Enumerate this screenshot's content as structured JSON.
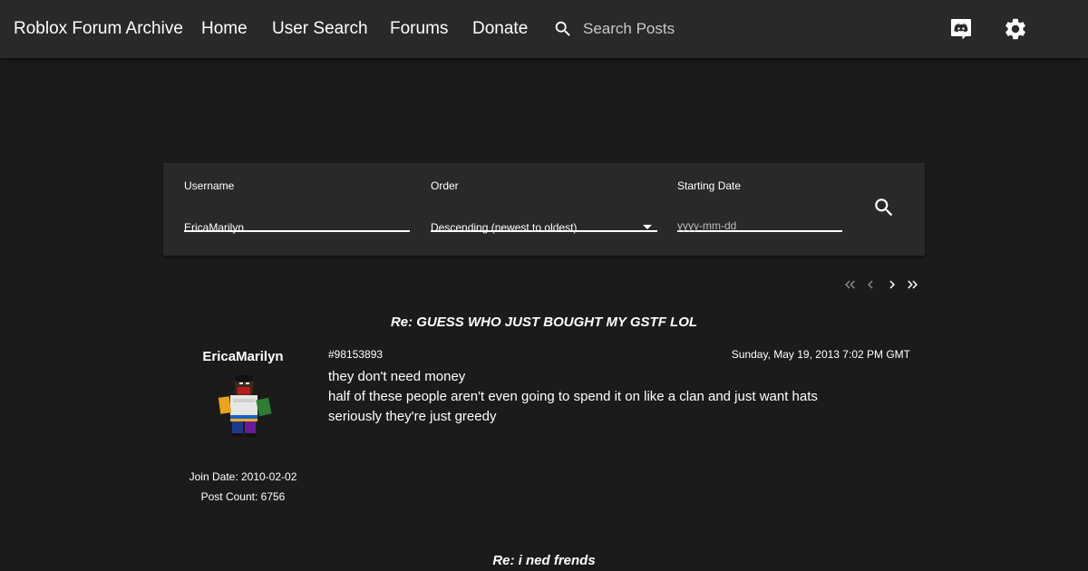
{
  "nav": {
    "brand": "Roblox Forum Archive",
    "links": [
      "Home",
      "User Search",
      "Forums",
      "Donate"
    ],
    "search_placeholder": "Search Posts",
    "icons": [
      "search-icon",
      "discord-icon",
      "gear-icon"
    ]
  },
  "filters": {
    "username_label": "Username",
    "username_value": "EricaMarilyn",
    "order_label": "Order",
    "order_value": "Descending (newest to oldest)",
    "date_label": "Starting Date",
    "date_placeholder": "yyyy-mm-dd"
  },
  "pager": {
    "icons": [
      "first-page-icon",
      "prev-page-icon",
      "next-page-icon",
      "last-page-icon"
    ]
  },
  "posts": [
    {
      "title": "Re: GUESS WHO JUST BOUGHT MY GSTF LOL",
      "author": "EricaMarilyn",
      "join_date": "Join Date: 2010-02-02",
      "post_count": "Post Count: 6756",
      "id": "#98153893",
      "date": "Sunday, May 19, 2013 7:02 PM GMT",
      "lines": [
        "they don't need money",
        "half of these people aren't even going to spend it on like a clan and just want hats",
        "seriously they're just greedy"
      ]
    },
    {
      "title": "Re: i ned frends"
    }
  ]
}
